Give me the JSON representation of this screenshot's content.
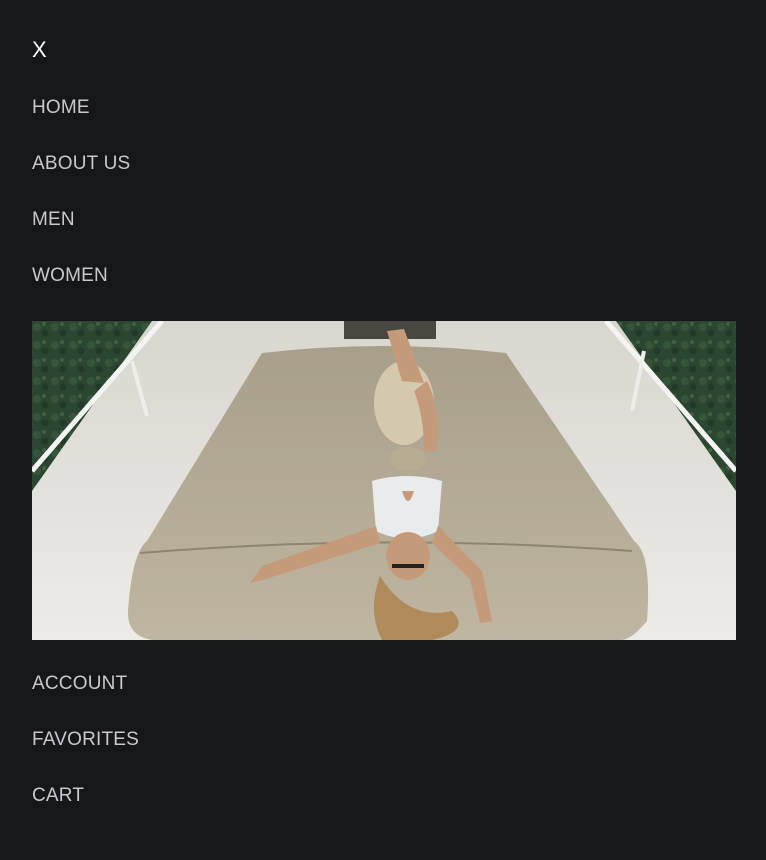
{
  "menu": {
    "close_label": "X",
    "primary_items": [
      {
        "label": "HOME"
      },
      {
        "label": "ABOUT US"
      },
      {
        "label": "MEN"
      },
      {
        "label": "WOMEN"
      }
    ],
    "secondary_items": [
      {
        "label": "ACCOUNT"
      },
      {
        "label": "FAVORITES"
      },
      {
        "label": "CART"
      }
    ]
  },
  "hero_image": {
    "subject": "woman-lying-on-boat-deck",
    "colors": {
      "water": "#2c4a33",
      "deck": "#e6e4df",
      "cushion": "#b6ad98",
      "background": "#16171b",
      "text": "#c9c9cd"
    }
  }
}
